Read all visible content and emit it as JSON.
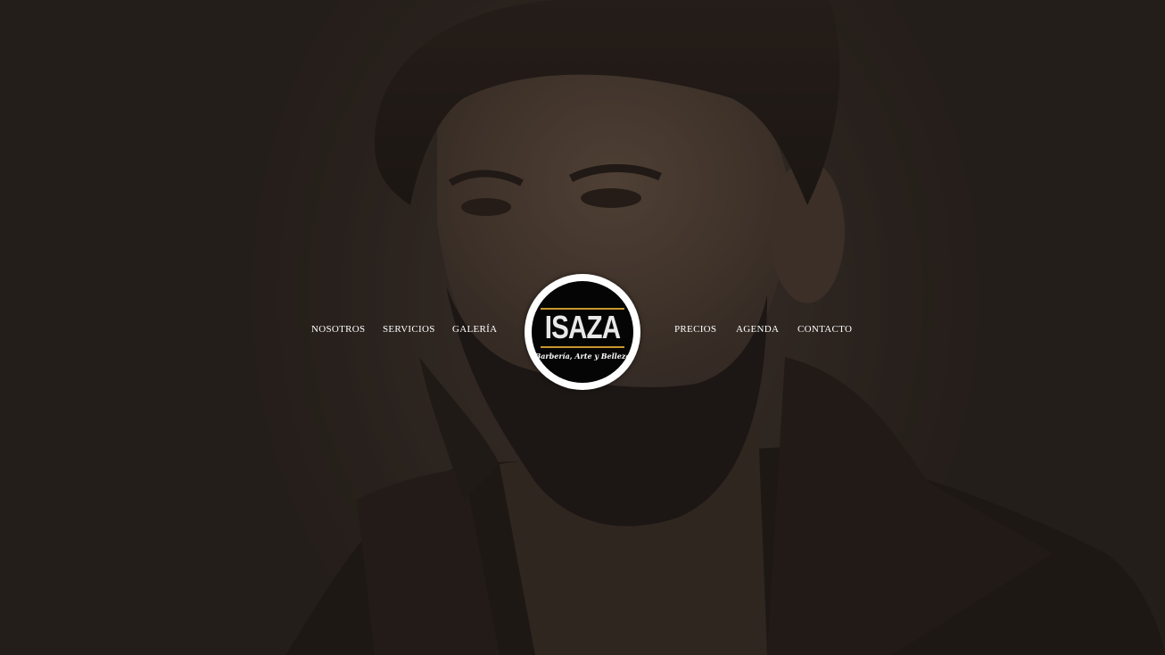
{
  "nav": {
    "left": [
      {
        "label": "NOSOTROS"
      },
      {
        "label": "SERVICIOS"
      },
      {
        "label": "GALERÍA"
      }
    ],
    "right": [
      {
        "label": "PRECIOS"
      },
      {
        "label": "AGENDA"
      },
      {
        "label": "CONTACTO"
      }
    ]
  },
  "logo": {
    "name": "ISAZA",
    "tagline": "Barbería, Arte y Belleza",
    "accent_color": "#c9962e"
  },
  "hero": {
    "image": "bearded-man-portrait"
  }
}
